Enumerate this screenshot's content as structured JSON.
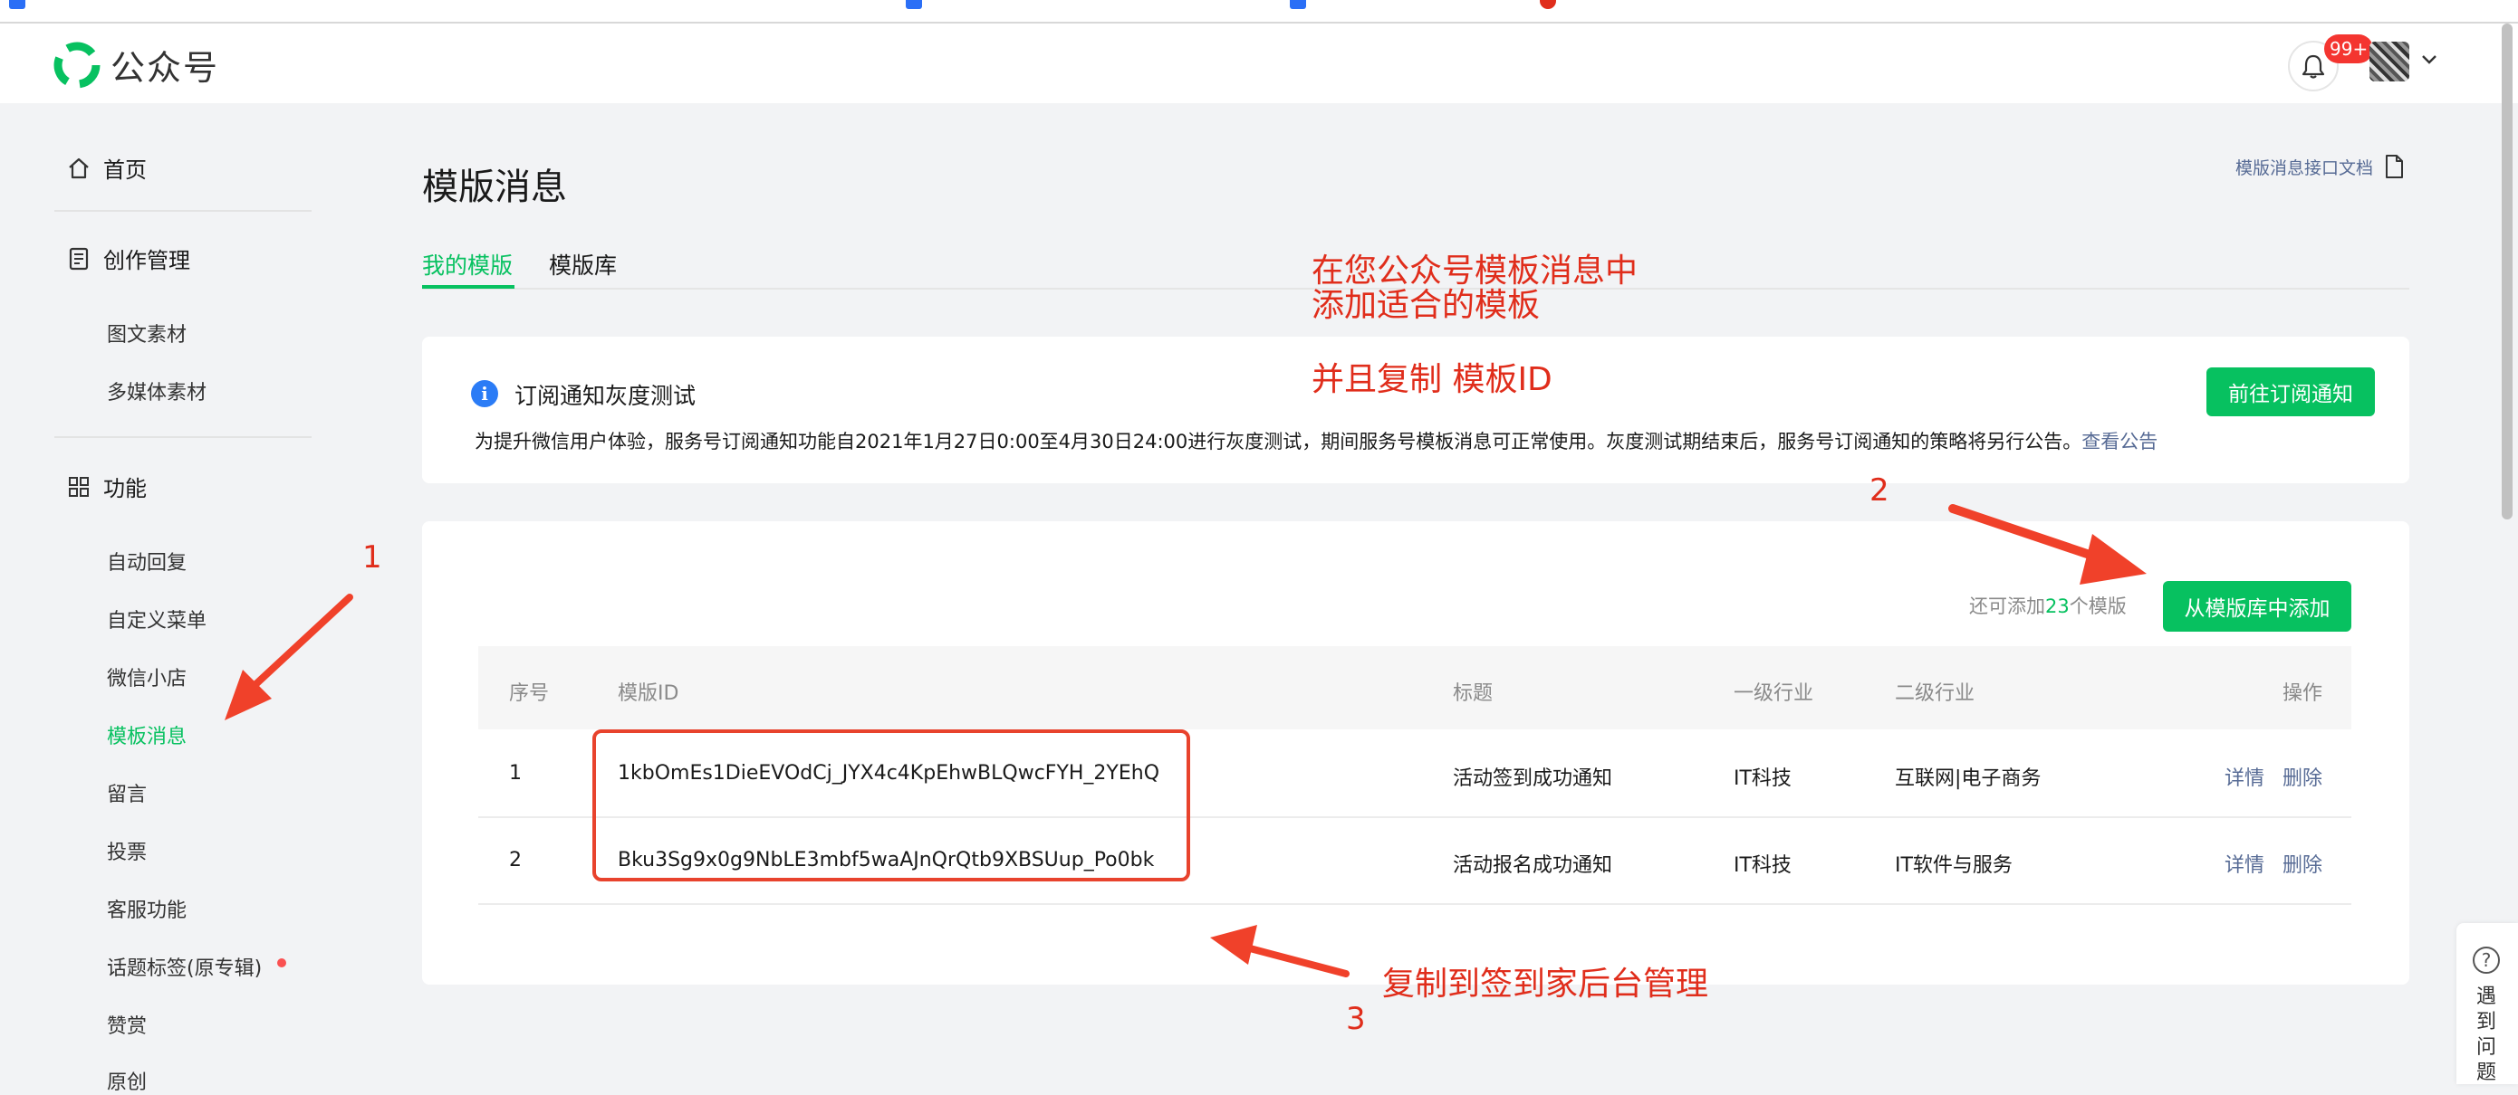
{
  "brand": {
    "name": "公众号",
    "accent": "#07c160"
  },
  "header": {
    "notification_count": "99+"
  },
  "sidebar": {
    "home": "首页",
    "creation": {
      "label": "创作管理",
      "items": [
        "图文素材",
        "多媒体素材"
      ]
    },
    "features": {
      "label": "功能",
      "items": [
        "自动回复",
        "自定义菜单",
        "微信小店",
        "模板消息",
        "留言",
        "投票",
        "客服功能",
        "话题标签(原专辑)",
        "赞赏",
        "原创"
      ],
      "active": "模板消息"
    }
  },
  "main": {
    "title": "模版消息",
    "doc_link": "模版消息接口文档",
    "tabs": [
      "我的模版",
      "模版库"
    ],
    "notice": {
      "title": "订阅通知灰度测试",
      "text": "为提升微信用户体验，服务号订阅通知功能自2021年1月27日0:00至4月30日24:00进行灰度测试，期间服务号模板消息可正常使用。灰度测试期结束后，服务号订阅通知的策略将另行公告。",
      "link": "查看公告",
      "button": "前往订阅通知"
    },
    "list": {
      "remain_prefix": "还可添加",
      "remain_count": "23",
      "remain_suffix": "个模版",
      "add_button": "从模版库中添加",
      "columns": [
        "序号",
        "模版ID",
        "标题",
        "一级行业",
        "二级行业",
        "操作"
      ],
      "rows": [
        {
          "no": "1",
          "id": "1kbOmEs1DieEVOdCj_JYX4c4KpEhwBLQwcFYH_2YEhQ",
          "title": "活动签到成功通知",
          "industry1": "IT科技",
          "industry2": "互联网|电子商务",
          "op_detail": "详情",
          "op_delete": "删除"
        },
        {
          "no": "2",
          "id": "Bku3Sg9x0g9NbLE3mbf5waAJnQrQtb9XBSUup_Po0bk",
          "title": "活动报名成功通知",
          "industry1": "IT科技",
          "industry2": "IT软件与服务",
          "op_detail": "详情",
          "op_delete": "删除"
        }
      ]
    }
  },
  "annotations": {
    "line1": "在您公众号模板消息中",
    "line2": "添加适合的模板",
    "line3": "并且复制 模板ID",
    "copy_note": "复制到签到家后台管理",
    "num1": "1",
    "num2": "2",
    "num3": "3",
    "color": "#e02d1b"
  },
  "help": {
    "label": "遇到问题"
  }
}
